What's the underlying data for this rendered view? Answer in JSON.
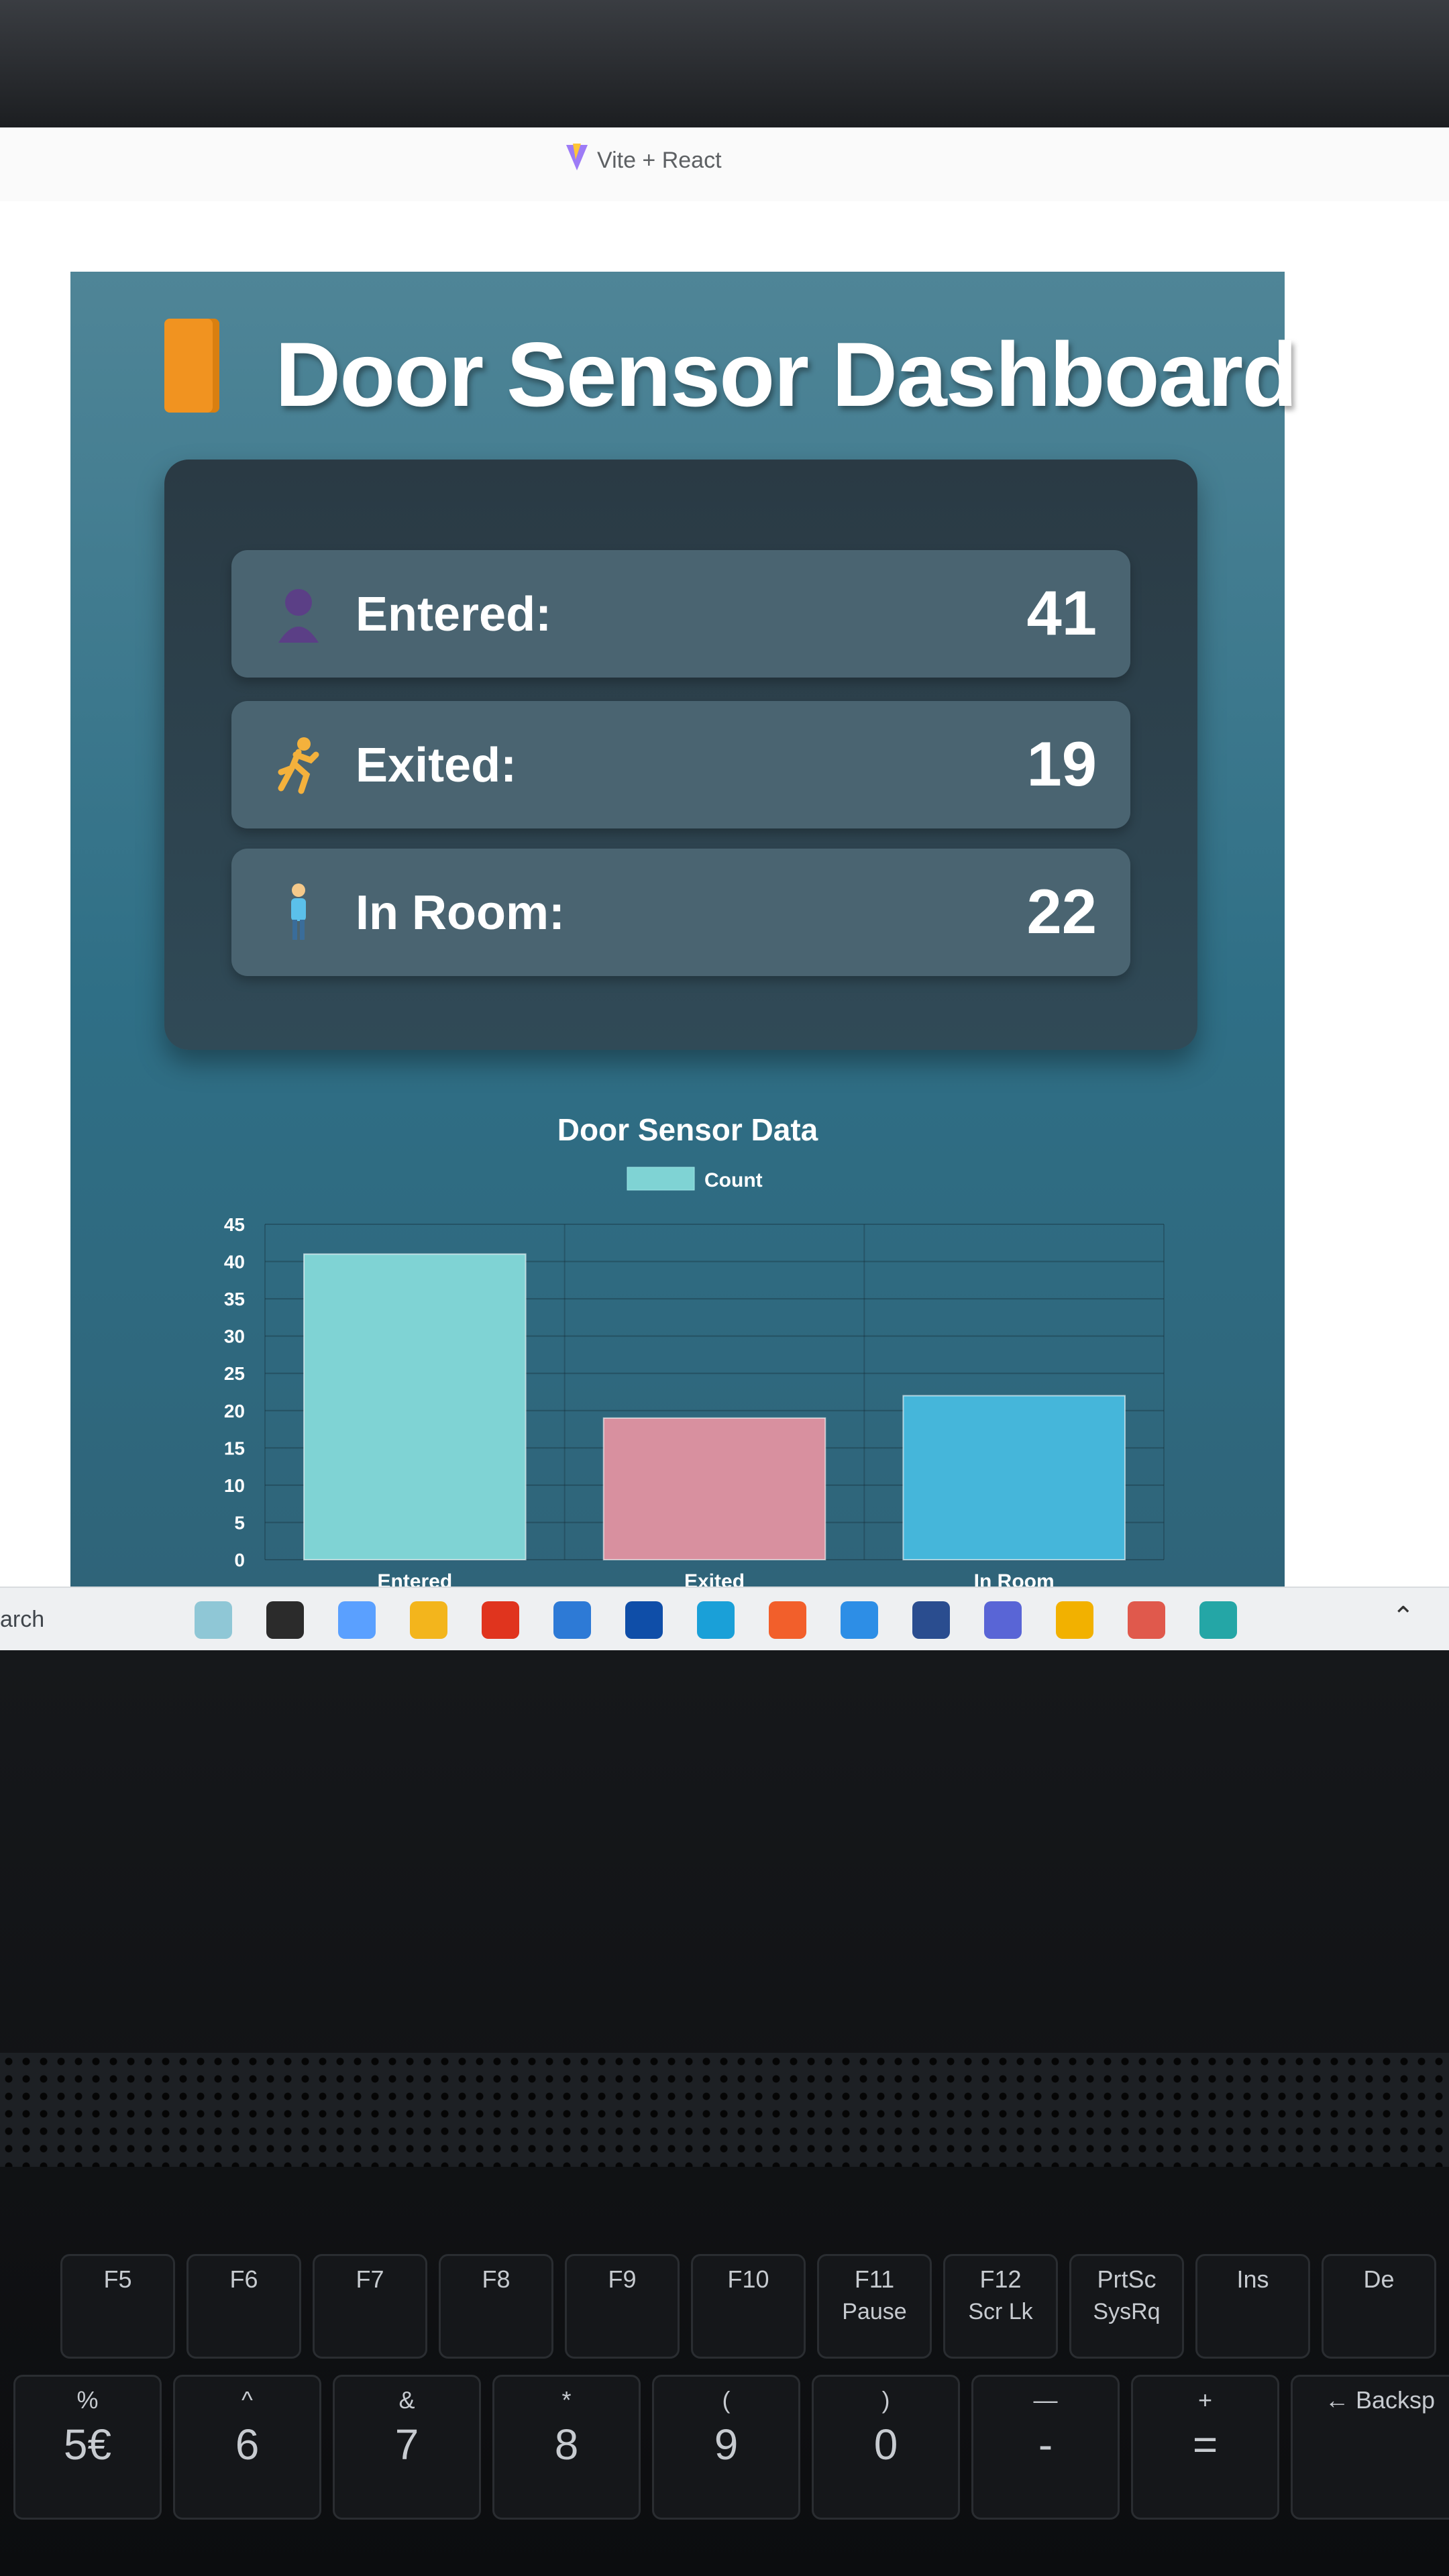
{
  "browser": {
    "tab_title": "Vite + React"
  },
  "dashboard": {
    "title": "Door Sensor Dashboard",
    "stats": [
      {
        "label": "Entered:",
        "value": "41",
        "icon": "person-silhouette-icon"
      },
      {
        "label": "Exited:",
        "value": "19",
        "icon": "running-person-icon"
      },
      {
        "label": "In Room:",
        "value": "22",
        "icon": "standing-person-icon"
      }
    ]
  },
  "chart_data": {
    "type": "bar",
    "title": "Door Sensor Data",
    "categories": [
      "Entered",
      "Exited",
      "In Room"
    ],
    "series": [
      {
        "name": "Count",
        "values": [
          41,
          19,
          22
        ]
      }
    ],
    "bar_colors": [
      "#7fd3d4",
      "#d8909f",
      "#45b6da"
    ],
    "ylim": [
      0,
      45
    ],
    "yticks": [
      "0",
      "5",
      "10",
      "15",
      "20",
      "25",
      "30",
      "35",
      "40",
      "45"
    ],
    "grid": true,
    "legend": "top"
  },
  "taskbar": {
    "search_text": "arch",
    "apps": [
      "widgets-icon",
      "task-view-icon",
      "copilot-icon",
      "file-explorer-icon",
      "opera-icon",
      "microsoft-store-icon",
      "dropbox-icon",
      "edge-icon",
      "brave-icon",
      "vscode-icon",
      "postman-icon",
      "teams-icon",
      "chrome-icon",
      "chrome-profile-icon",
      "arduino-icon"
    ]
  },
  "keyboard": {
    "function_keys": [
      {
        "label": "F5"
      },
      {
        "label": "F6"
      },
      {
        "label": "F7"
      },
      {
        "label": "F8"
      },
      {
        "label": "F9"
      },
      {
        "label": "F10"
      },
      {
        "label": "F11",
        "sub": "Pause"
      },
      {
        "label": "F12",
        "sub": "Scr Lk"
      },
      {
        "label": "PrtSc",
        "sub": "SysRq"
      },
      {
        "label": "Ins"
      },
      {
        "label": "De"
      }
    ],
    "number_keys": [
      {
        "top": "%",
        "main": "5€"
      },
      {
        "top": "^",
        "main": "6"
      },
      {
        "top": "&",
        "main": "7"
      },
      {
        "top": "*",
        "main": "8"
      },
      {
        "top": "(",
        "main": "9"
      },
      {
        "top": ")",
        "main": "0"
      },
      {
        "top": "—",
        "main": "-"
      },
      {
        "top": "+",
        "main": "="
      },
      {
        "top": "← Backsp",
        "main": ""
      }
    ]
  }
}
